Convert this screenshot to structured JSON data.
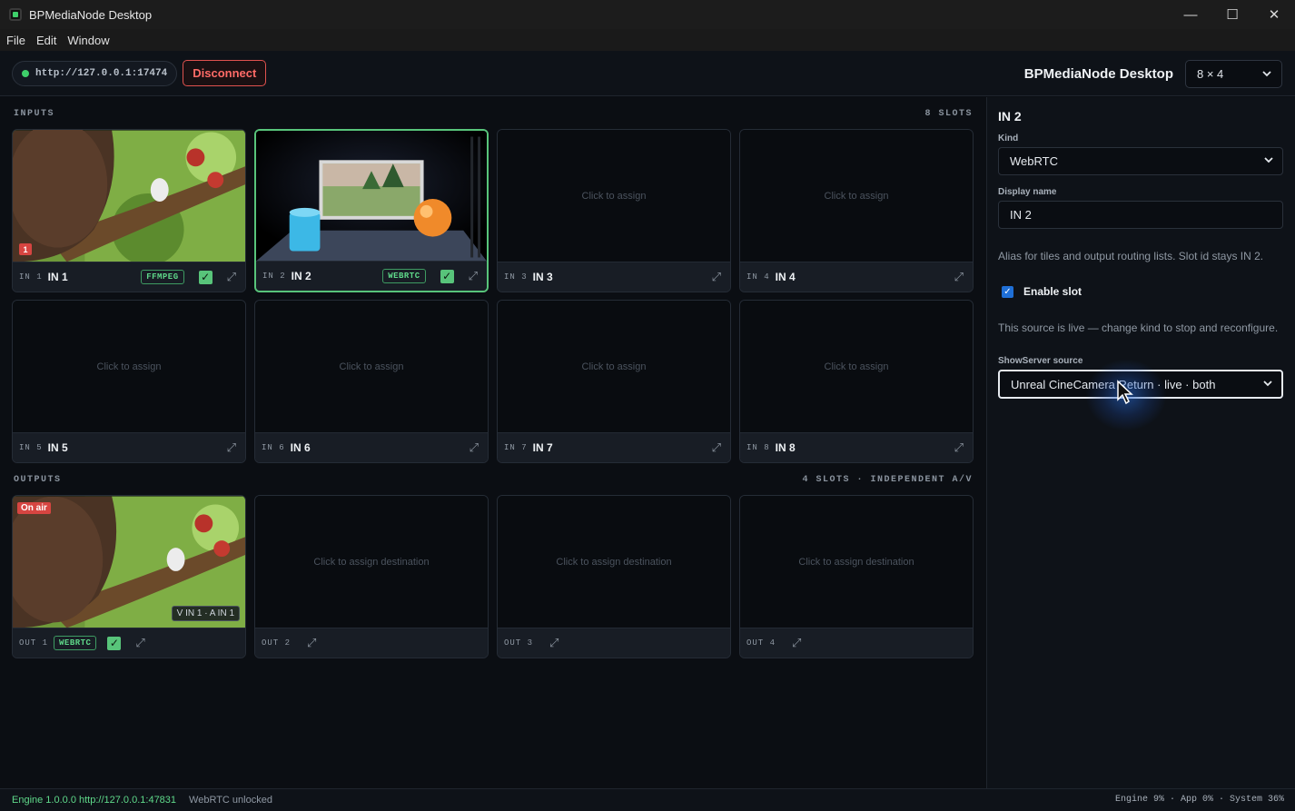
{
  "window": {
    "title": "BPMediaNode Desktop"
  },
  "menu": [
    "File",
    "Edit",
    "Window"
  ],
  "toolbar": {
    "server_url": "http://127.0.0.1:17474",
    "disconnect_label": "Disconnect",
    "app_heading": "BPMediaNode Desktop",
    "layout_value": "8 × 4"
  },
  "inputs": {
    "label": "INPUTS",
    "count_label": "8 SLOTS",
    "placeholder": "Click to assign",
    "slots": [
      {
        "id": "IN 1",
        "name": "IN 1",
        "kind": "FFMPEG",
        "enabled": true,
        "badge": "1"
      },
      {
        "id": "IN 2",
        "name": "IN 2",
        "kind": "WEBRTC",
        "enabled": true
      },
      {
        "id": "IN 3",
        "name": "IN 3"
      },
      {
        "id": "IN 4",
        "name": "IN 4"
      },
      {
        "id": "IN 5",
        "name": "IN 5"
      },
      {
        "id": "IN 6",
        "name": "IN 6"
      },
      {
        "id": "IN 7",
        "name": "IN 7"
      },
      {
        "id": "IN 8",
        "name": "IN 8"
      }
    ]
  },
  "outputs": {
    "label": "OUTPUTS",
    "count_label": "4 SLOTS · INDEPENDENT A/V",
    "placeholder": "Click to assign destination",
    "slots": [
      {
        "id": "OUT 1",
        "kind": "WEBRTC",
        "enabled": true,
        "on_air": "On air",
        "route": "V IN 1 · A IN 1"
      },
      {
        "id": "OUT 2"
      },
      {
        "id": "OUT 3"
      },
      {
        "id": "OUT 4"
      }
    ]
  },
  "panel": {
    "title": "IN 2",
    "kind_label": "Kind",
    "kind_value": "WebRTC",
    "display_name_label": "Display name",
    "display_name_value": "IN 2",
    "alias_help": "Alias for tiles and output routing lists. Slot id stays IN 2.",
    "enable_label": "Enable slot",
    "live_help": "This source is live — change kind to stop and reconfigure.",
    "source_label": "ShowServer source",
    "source_value": "Unreal CineCamera Return · live · both"
  },
  "status": {
    "engine": "Engine 1.0.0.0 http://127.0.0.1:47831",
    "webrtc": "WebRTC unlocked",
    "usage": "Engine 9% · App 0% · System 36%"
  },
  "colors": {
    "accent_green": "#58c47a",
    "danger_red": "#e0524f",
    "focus_blue": "#1f6fd6"
  }
}
